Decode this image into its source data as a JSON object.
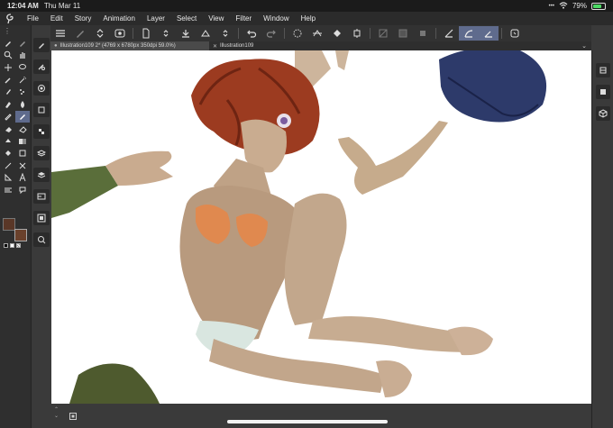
{
  "status": {
    "time": "12:04 AM",
    "date": "Thu Mar 11",
    "battery_text": "79%",
    "battery_level": 0.79,
    "icons": [
      "wifi-icon",
      "battery-icon"
    ]
  },
  "menu": {
    "items": [
      "File",
      "Edit",
      "Story",
      "Animation",
      "Layer",
      "Select",
      "View",
      "Filter",
      "Window",
      "Help"
    ]
  },
  "tabs": [
    {
      "label": "Illustration109 2* (4769 x 6780px 350dpi 59.0%)",
      "active": true
    },
    {
      "label": "Illustration109",
      "active": false
    }
  ],
  "colors": {
    "accent": "#5f6b8d",
    "main_color": "#5a3727",
    "sub_color": "#6a412c"
  }
}
